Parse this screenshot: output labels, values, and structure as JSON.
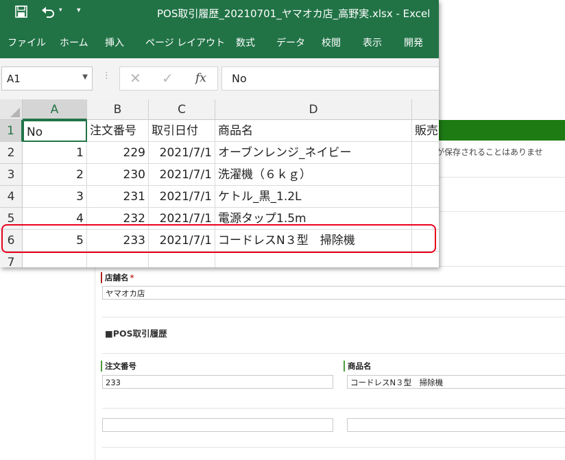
{
  "form": {
    "notice": "が保存されることはありませ",
    "store_label": "店舗名",
    "store_required": "*",
    "store_value": "ヤマオカ店",
    "section_title": "■POS取引履歴",
    "order_label": "注文番号",
    "order_value": "233",
    "product_label": "商品名",
    "product_value": "コードレスN３型　掃除機"
  },
  "excel": {
    "title": "POS取引履歴_20210701_ヤマオカ店_高野実.xlsx  -  Excel",
    "tabs": [
      "ファイル",
      "ホーム",
      "挿入",
      "ページ レイアウト",
      "数式",
      "データ",
      "校閲",
      "表示",
      "開発"
    ],
    "name_box": "A1",
    "formula_value": "No",
    "fx_label": "fx",
    "columns": [
      "A",
      "B",
      "C",
      "D",
      ""
    ],
    "row_numbers": [
      "1",
      "2",
      "3",
      "4",
      "5",
      "6",
      "7"
    ],
    "rows": [
      [
        "No",
        "注文番号",
        "取引日付",
        "商品名",
        "販売"
      ],
      [
        "1",
        "229",
        "2021/7/1",
        "オーブンレンジ_ネイビー",
        ""
      ],
      [
        "2",
        "230",
        "2021/7/1",
        "洗濯機（６ｋｇ）",
        ""
      ],
      [
        "3",
        "231",
        "2021/7/1",
        "ケトル_黒_1.2L",
        ""
      ],
      [
        "4",
        "232",
        "2021/7/1",
        "電源タップ1.5m",
        ""
      ],
      [
        "5",
        "233",
        "2021/7/1",
        "コードレスN３型　掃除機",
        ""
      ],
      [
        "",
        "",
        "",
        "",
        ""
      ]
    ]
  },
  "colors": {
    "excel_green": "#217346",
    "form_header": "#1e7b14",
    "highlight": "#e8001c"
  }
}
